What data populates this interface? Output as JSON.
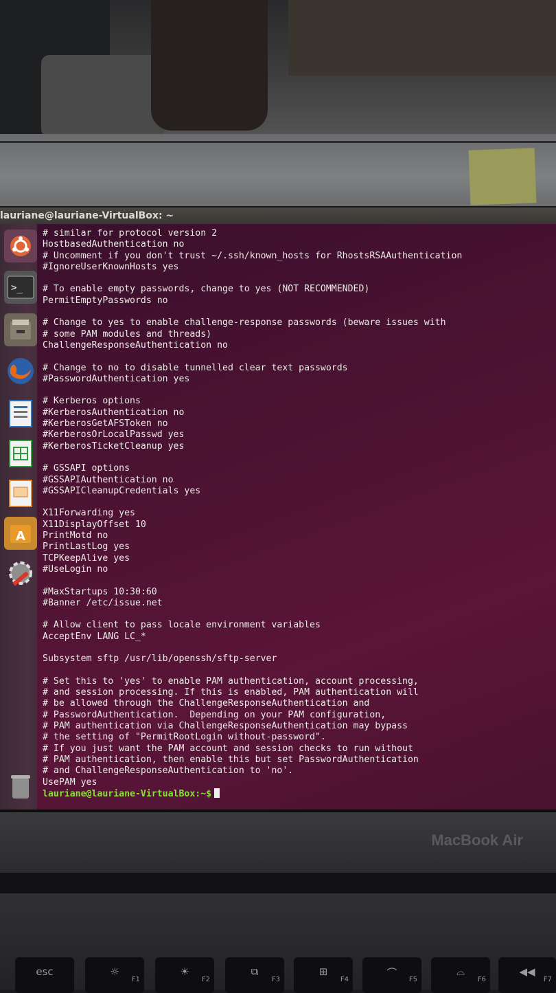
{
  "window": {
    "title": "lauriane@lauriane-VirtualBox: ~"
  },
  "launcher": {
    "items": [
      {
        "name": "ubuntu-dash-icon",
        "color": "#e0663a"
      },
      {
        "name": "terminal-icon",
        "color": "#2d2d2d"
      },
      {
        "name": "files-icon",
        "color": "#8a8172"
      },
      {
        "name": "firefox-icon",
        "color": "#e66a1d"
      },
      {
        "name": "writer-icon",
        "color": "#2f6db5"
      },
      {
        "name": "calc-icon",
        "color": "#2f9a3b"
      },
      {
        "name": "impress-icon",
        "color": "#d9822b"
      },
      {
        "name": "software-center-icon",
        "color": "#e89a2a"
      },
      {
        "name": "settings-icon",
        "color": "#d8382c"
      },
      {
        "name": "trash-icon",
        "color": "#8e8e8e"
      }
    ]
  },
  "terminal": {
    "lines": [
      "# similar for protocol version 2",
      "HostbasedAuthentication no",
      "# Uncomment if you don't trust ~/.ssh/known_hosts for RhostsRSAAuthentication",
      "#IgnoreUserKnownHosts yes",
      "",
      "# To enable empty passwords, change to yes (NOT RECOMMENDED)",
      "PermitEmptyPasswords no",
      "",
      "# Change to yes to enable challenge-response passwords (beware issues with",
      "# some PAM modules and threads)",
      "ChallengeResponseAuthentication no",
      "",
      "# Change to no to disable tunnelled clear text passwords",
      "#PasswordAuthentication yes",
      "",
      "# Kerberos options",
      "#KerberosAuthentication no",
      "#KerberosGetAFSToken no",
      "#KerberosOrLocalPasswd yes",
      "#KerberosTicketCleanup yes",
      "",
      "# GSSAPI options",
      "#GSSAPIAuthentication no",
      "#GSSAPICleanupCredentials yes",
      "",
      "X11Forwarding yes",
      "X11DisplayOffset 10",
      "PrintMotd no",
      "PrintLastLog yes",
      "TCPKeepAlive yes",
      "#UseLogin no",
      "",
      "#MaxStartups 10:30:60",
      "#Banner /etc/issue.net",
      "",
      "# Allow client to pass locale environment variables",
      "AcceptEnv LANG LC_*",
      "",
      "Subsystem sftp /usr/lib/openssh/sftp-server",
      "",
      "# Set this to 'yes' to enable PAM authentication, account processing,",
      "# and session processing. If this is enabled, PAM authentication will",
      "# be allowed through the ChallengeResponseAuthentication and",
      "# PasswordAuthentication.  Depending on your PAM configuration,",
      "# PAM authentication via ChallengeResponseAuthentication may bypass",
      "# the setting of \"PermitRootLogin without-password\".",
      "# If you just want the PAM account and session checks to run without",
      "# PAM authentication, then enable this but set PasswordAuthentication",
      "# and ChallengeResponseAuthentication to 'no'.",
      "UsePAM yes"
    ],
    "prompt": "lauriane@lauriane-VirtualBox:~$"
  },
  "laptop": {
    "brand": "MacBook Air"
  },
  "keyboard": {
    "keys": [
      {
        "main": "esc",
        "sub": ""
      },
      {
        "main": "☼",
        "sub": "F1"
      },
      {
        "main": "☀",
        "sub": "F2"
      },
      {
        "main": "⧉",
        "sub": "F3"
      },
      {
        "main": "⊞",
        "sub": "F4"
      },
      {
        "main": "⌒",
        "sub": "F5"
      },
      {
        "main": "⌓",
        "sub": "F6"
      },
      {
        "main": "◀◀",
        "sub": "F7"
      }
    ]
  }
}
